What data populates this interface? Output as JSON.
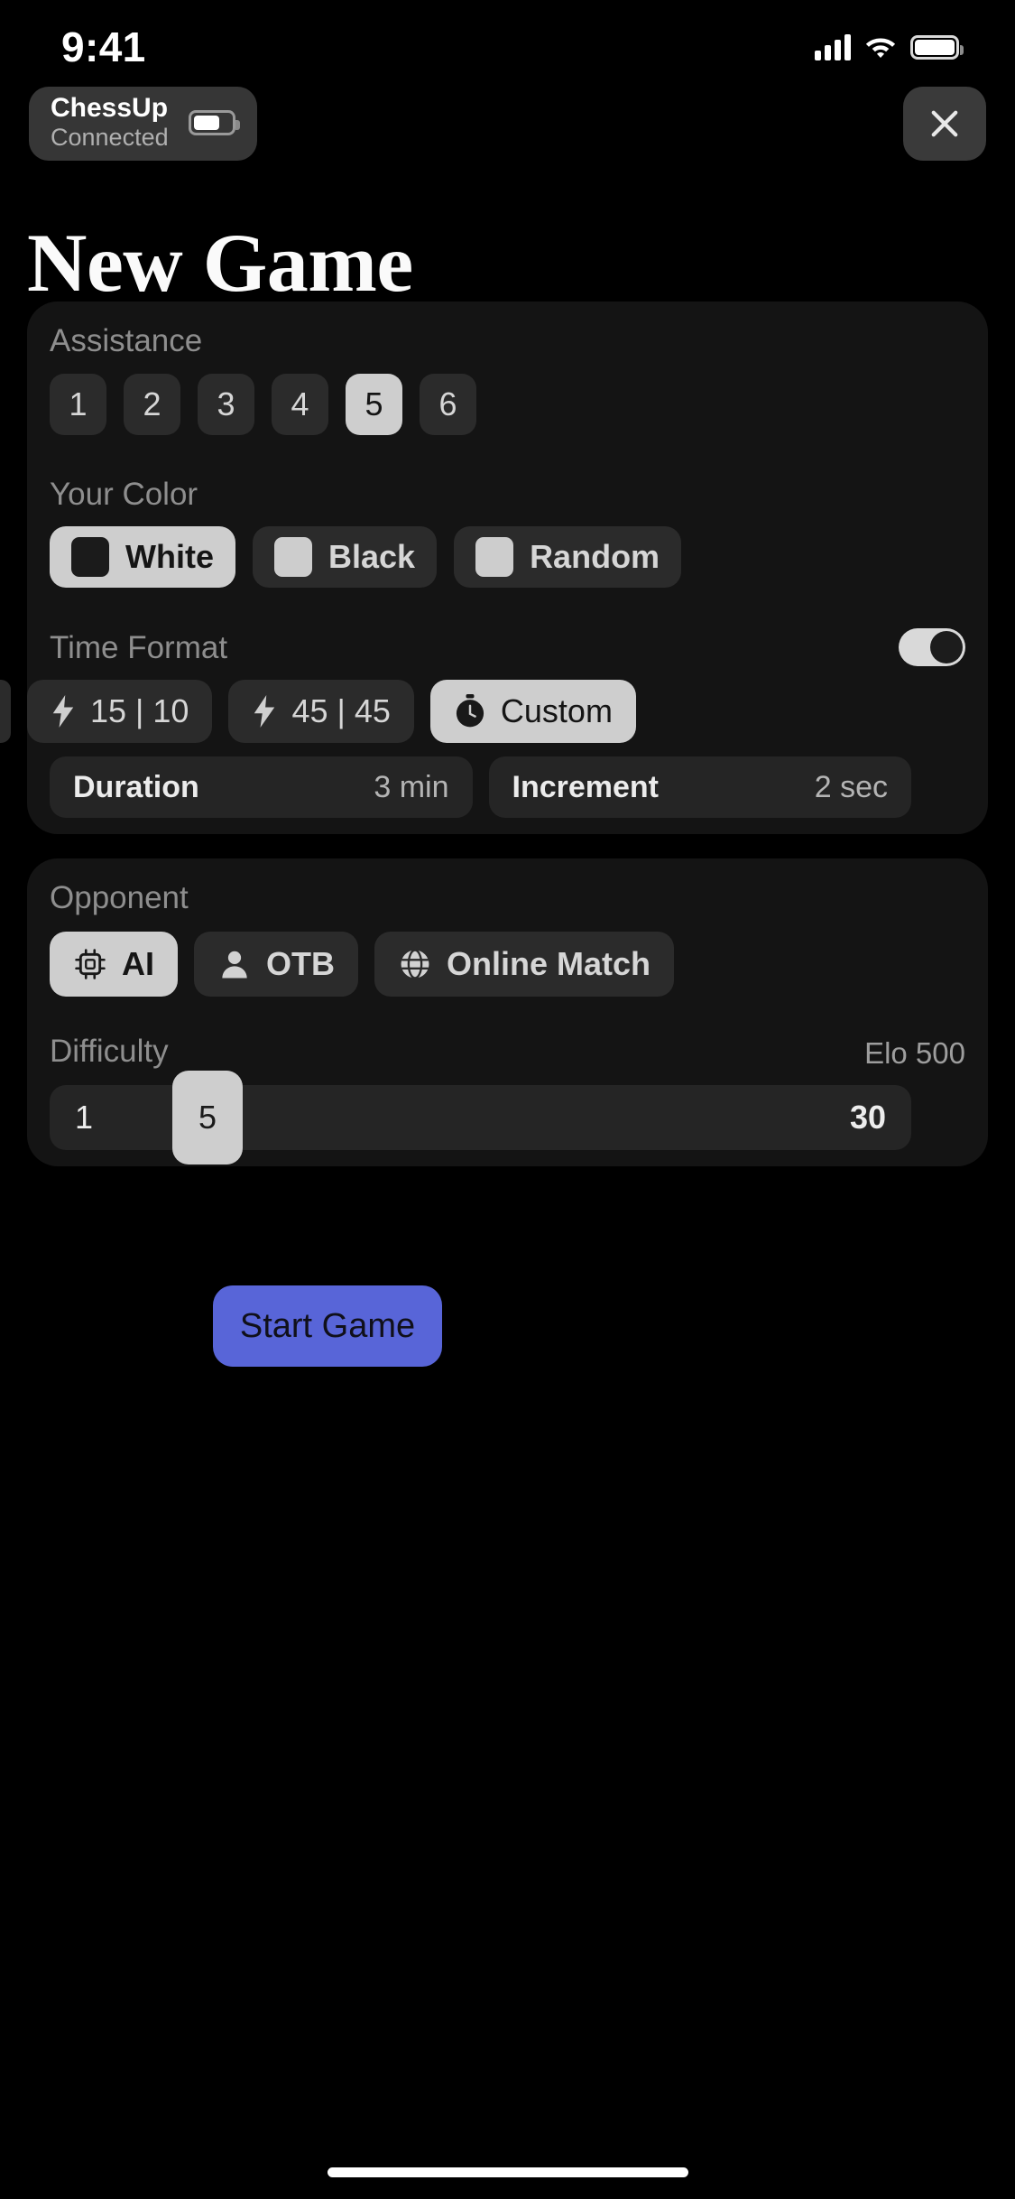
{
  "status_bar": {
    "time": "9:41",
    "icons": [
      "cellular-signal-icon",
      "wifi-icon",
      "battery-icon"
    ]
  },
  "device_badge": {
    "name": "ChessUp",
    "status": "Connected",
    "battery_icon": "battery-icon"
  },
  "close_button": {
    "icon": "close-icon"
  },
  "page_title": "New Game",
  "game_card": {
    "assistance": {
      "label": "Assistance",
      "options": [
        "1",
        "2",
        "3",
        "4",
        "5",
        "6"
      ],
      "selected": "5"
    },
    "your_color": {
      "label": "Your Color",
      "options": [
        {
          "label": "White",
          "swatch": "dark",
          "selected": true
        },
        {
          "label": "Black",
          "swatch": "light",
          "selected": false
        },
        {
          "label": "Random",
          "swatch": "light",
          "selected": false
        }
      ]
    },
    "time_format": {
      "label": "Time Format",
      "toggle_on": true,
      "presets": [
        {
          "label": "15 | 10",
          "icon": "lightning-bolt-icon",
          "selected": false
        },
        {
          "label": "45 | 45",
          "icon": "lightning-bolt-icon",
          "selected": false
        },
        {
          "label": "Custom",
          "icon": "stopwatch-icon",
          "selected": true
        }
      ],
      "duration": {
        "label": "Duration",
        "value": "3 min"
      },
      "increment": {
        "label": "Increment",
        "value": "2 sec"
      }
    }
  },
  "opponent_card": {
    "label": "Opponent",
    "options": [
      {
        "label": "AI",
        "icon": "cpu-chip-icon",
        "selected": true
      },
      {
        "label": "OTB",
        "icon": "person-icon",
        "selected": false
      },
      {
        "label": "Online Match",
        "icon": "globe-icon",
        "selected": false
      }
    ],
    "difficulty": {
      "label": "Difficulty",
      "elo": "Elo 500",
      "min": "1",
      "max": "30",
      "value": "5"
    }
  },
  "start_button": {
    "label": "Start Game",
    "color": "#5865d8"
  }
}
